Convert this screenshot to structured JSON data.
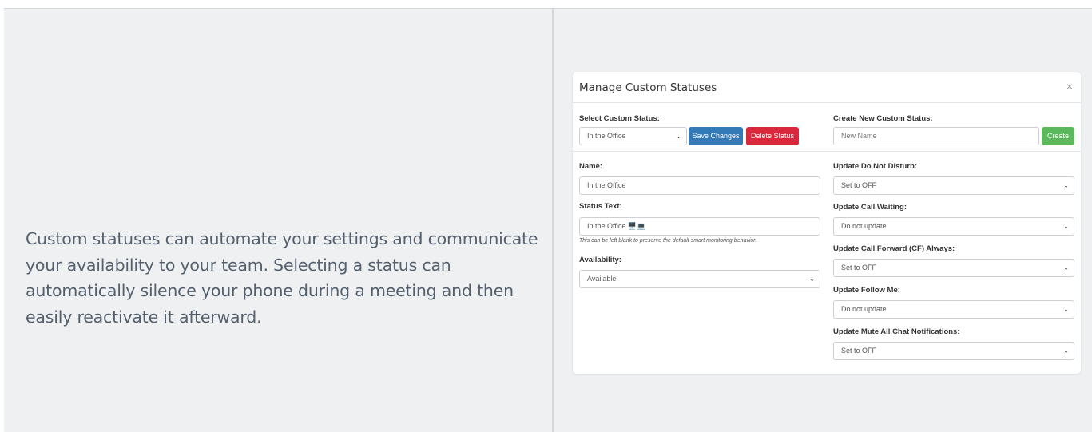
{
  "intro": {
    "text": "Custom statuses can automate your settings and communicate your availability to your team. Selecting a status can automatically silence your phone during a meeting and then easily reactivate it afterward."
  },
  "modal": {
    "title": "Manage Custom Statuses",
    "close": "×",
    "select_status_label": "Select Custom Status:",
    "select_status_value": "In the Office",
    "save_label": "Save Changes",
    "delete_label": "Delete Status",
    "create_label": "Create New Custom Status:",
    "create_placeholder": "New Name",
    "create_button": "Create",
    "name_label": "Name:",
    "name_value": "In the Office",
    "status_text_label": "Status Text:",
    "status_text_value": "In the Office 🖥️💻",
    "status_text_hint": "This can be left blank to preserve the default smart monitoring behavior.",
    "availability_label": "Availability:",
    "availability_value": "Available",
    "dnd_label": "Update Do Not Disturb:",
    "dnd_value": "Set to OFF",
    "call_waiting_label": "Update Call Waiting:",
    "call_waiting_value": "Do not update",
    "cf_label": "Update Call Forward (CF) Always:",
    "cf_value": "Set to OFF",
    "follow_me_label": "Update Follow Me:",
    "follow_me_value": "Do not update",
    "mute_chat_label": "Update Mute All Chat Notifications:",
    "mute_chat_value": "Set to OFF"
  },
  "icons": {
    "chevron": "chevron-down-icon",
    "close": "close-icon"
  },
  "colors": {
    "primary": "#337ab7",
    "danger": "#d9283c",
    "success": "#5cb85c",
    "panel_bg": "#eff0f2"
  }
}
